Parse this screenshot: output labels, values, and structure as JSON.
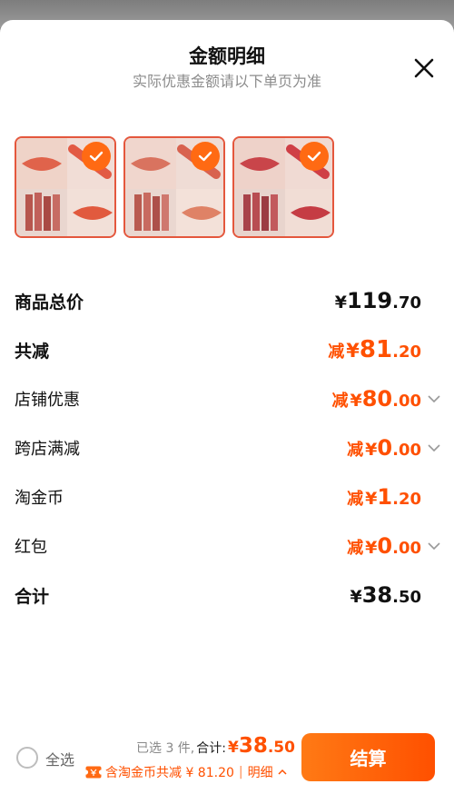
{
  "sheet": {
    "title": "金额明细",
    "subtitle": "实际优惠金额请以下单页为准"
  },
  "products": [
    {
      "name": "lip-swatch-1",
      "selected": true
    },
    {
      "name": "lip-swatch-2",
      "selected": true
    },
    {
      "name": "lip-swatch-3",
      "selected": true
    }
  ],
  "rows": {
    "goods_total": {
      "label": "商品总价",
      "symbol": "¥",
      "int": "119",
      "dec": ".70"
    },
    "total_reduce": {
      "label": "共减",
      "prefix": "减",
      "symbol": "¥",
      "int": "81",
      "dec": ".20"
    },
    "shop_discount": {
      "label": "店铺优惠",
      "prefix": "减",
      "symbol": "¥",
      "int": "80",
      "dec": ".00"
    },
    "cross_shop": {
      "label": "跨店满减",
      "prefix": "减",
      "symbol": "¥",
      "int": "0",
      "dec": ".00"
    },
    "taobao_coin": {
      "label": "淘金币",
      "prefix": "减",
      "symbol": "¥",
      "int": "1",
      "dec": ".20"
    },
    "red_packet": {
      "label": "红包",
      "prefix": "减",
      "symbol": "¥",
      "int": "0",
      "dec": ".00"
    },
    "sum": {
      "label": "合计",
      "symbol": "¥",
      "int": "38",
      "dec": ".50"
    }
  },
  "footer": {
    "select_all": "全选",
    "selected_count": "已选 3 件,",
    "heji": "合计:",
    "total_symbol": "¥",
    "total_int": "38",
    "total_dec": ".50",
    "coin_reduce": "含淘金币共减 ¥ 81.20",
    "detail": "明细",
    "checkout": "结算"
  },
  "colors": {
    "accent": "#ff5000",
    "check": "#ff6a13",
    "thumb_border": "#e4573d"
  }
}
